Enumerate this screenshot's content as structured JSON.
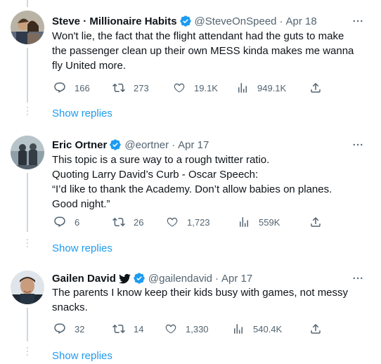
{
  "colors": {
    "accent": "#1d9bf0",
    "muted": "#536471",
    "text": "#0f1419",
    "border": "#eff3f4"
  },
  "tweets": [
    {
      "name": "Steve · Millionaire Habits",
      "handle": "@SteveOnSpeed",
      "date": "Apr 18",
      "lines": [
        "Won't lie, the fact that the flight attendant had the guts to make",
        "the passenger clean up their own MESS kinda makes me wanna",
        "fly United more."
      ],
      "replies": "166",
      "retweets": "273",
      "likes": "19.1K",
      "views": "949.1K",
      "show_replies": "Show replies"
    },
    {
      "name": "Eric Ortner",
      "handle": "@eortner",
      "date": "Apr 17",
      "lines": [
        "This topic is a sure way to a rough twitter ratio.",
        "Quoting Larry David’s Curb - Oscar Speech:",
        "“I’d like to thank the Academy. Don’t allow babies on planes.",
        "Good night.”"
      ],
      "replies": "6",
      "retweets": "26",
      "likes": "1,723",
      "views": "559K",
      "show_replies": "Show replies"
    },
    {
      "name": "Gailen David",
      "handle": "@gailendavid",
      "date": "Apr 17",
      "lines": [
        "The parents I know keep their kids busy with games, not messy",
        "snacks."
      ],
      "replies": "32",
      "retweets": "14",
      "likes": "1,330",
      "views": "540.4K",
      "show_replies": "Show replies"
    }
  ],
  "icons": {
    "reply": "reply-icon",
    "retweet": "retweet-icon",
    "like": "heart-icon",
    "views": "views-icon",
    "share": "share-icon",
    "more": "more-icon",
    "verified": "verified-badge-icon",
    "bird": "twitter-bird-icon"
  }
}
